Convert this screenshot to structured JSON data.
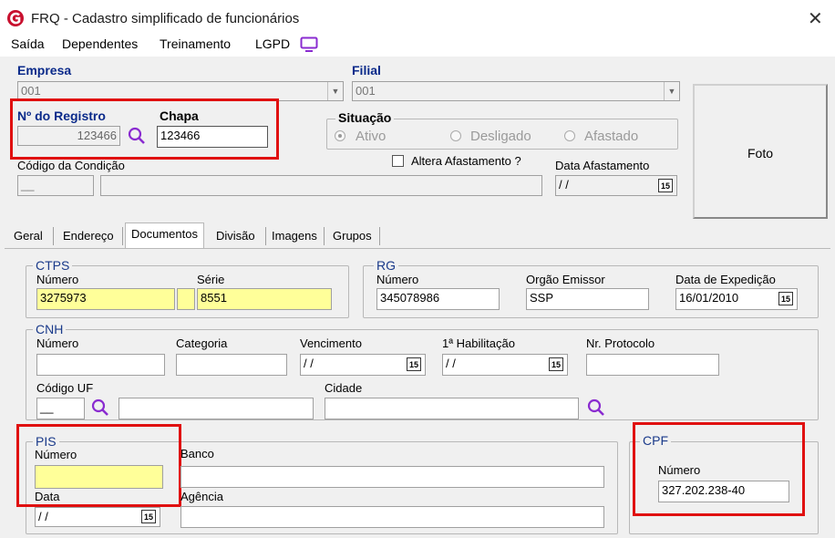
{
  "window": {
    "title": "FRQ - Cadastro simplificado de funcionários",
    "close_glyph": "✕"
  },
  "menu": {
    "items": [
      "Saída",
      "Dependentes",
      "Treinamento",
      "LGPD"
    ]
  },
  "header": {
    "empresa_label": "Empresa",
    "empresa_value": "001",
    "filial_label": "Filial",
    "filial_value": "001",
    "registro_label": "Nº do Registro",
    "registro_value": "123466",
    "chapa_label": "Chapa",
    "chapa_value": "123466",
    "situacao_label": "Situação",
    "situacao_options": [
      "Ativo",
      "Desligado",
      "Afastado"
    ],
    "situacao_selected": "Ativo",
    "codigo_condicao_label": "Código da Condição",
    "codigo_condicao_value": "__",
    "altera_afastamento_label": "Altera Afastamento ?",
    "data_afastamento_label": "Data Afastamento",
    "data_afastamento_value": "/ /",
    "foto_label": "Foto"
  },
  "tabs": [
    "Geral",
    "Endereço",
    "Documentos",
    "Divisão",
    "Imagens",
    "Grupos"
  ],
  "active_tab": "Documentos",
  "ctps": {
    "title": "CTPS",
    "numero_label": "Número",
    "numero_value": "3275973",
    "serie_label": "Série",
    "serie_value": "8551"
  },
  "rg": {
    "title": "RG",
    "numero_label": "Número",
    "numero_value": "345078986",
    "orgao_label": "Orgão Emissor",
    "orgao_value": "SSP",
    "data_label": "Data de Expedição",
    "data_value": "16/01/2010"
  },
  "cnh": {
    "title": "CNH",
    "numero_label": "Número",
    "categoria_label": "Categoria",
    "vencimento_label": "Vencimento",
    "vencimento_value": "/ /",
    "habilitacao_label": "1ª Habilitação",
    "habilitacao_value": "/ /",
    "protocolo_label": "Nr. Protocolo",
    "codigo_uf_label": "Código UF",
    "codigo_uf_value": "__",
    "cidade_label": "Cidade"
  },
  "pis": {
    "title": "PIS",
    "numero_label": "Número",
    "numero_value": "",
    "data_label": "Data",
    "data_value": "/ /",
    "banco_label": "Banco",
    "agencia_label": "Agência"
  },
  "cpf": {
    "title": "CPF",
    "numero_label": "Número",
    "numero_value": "327.202.238-40"
  },
  "calendar_glyph": "15",
  "colors": {
    "highlight_yellow": "#ffff99",
    "annotation_red": "#e01010",
    "label_blue": "#0a2a8a",
    "search_purple": "#8a2bd0"
  }
}
